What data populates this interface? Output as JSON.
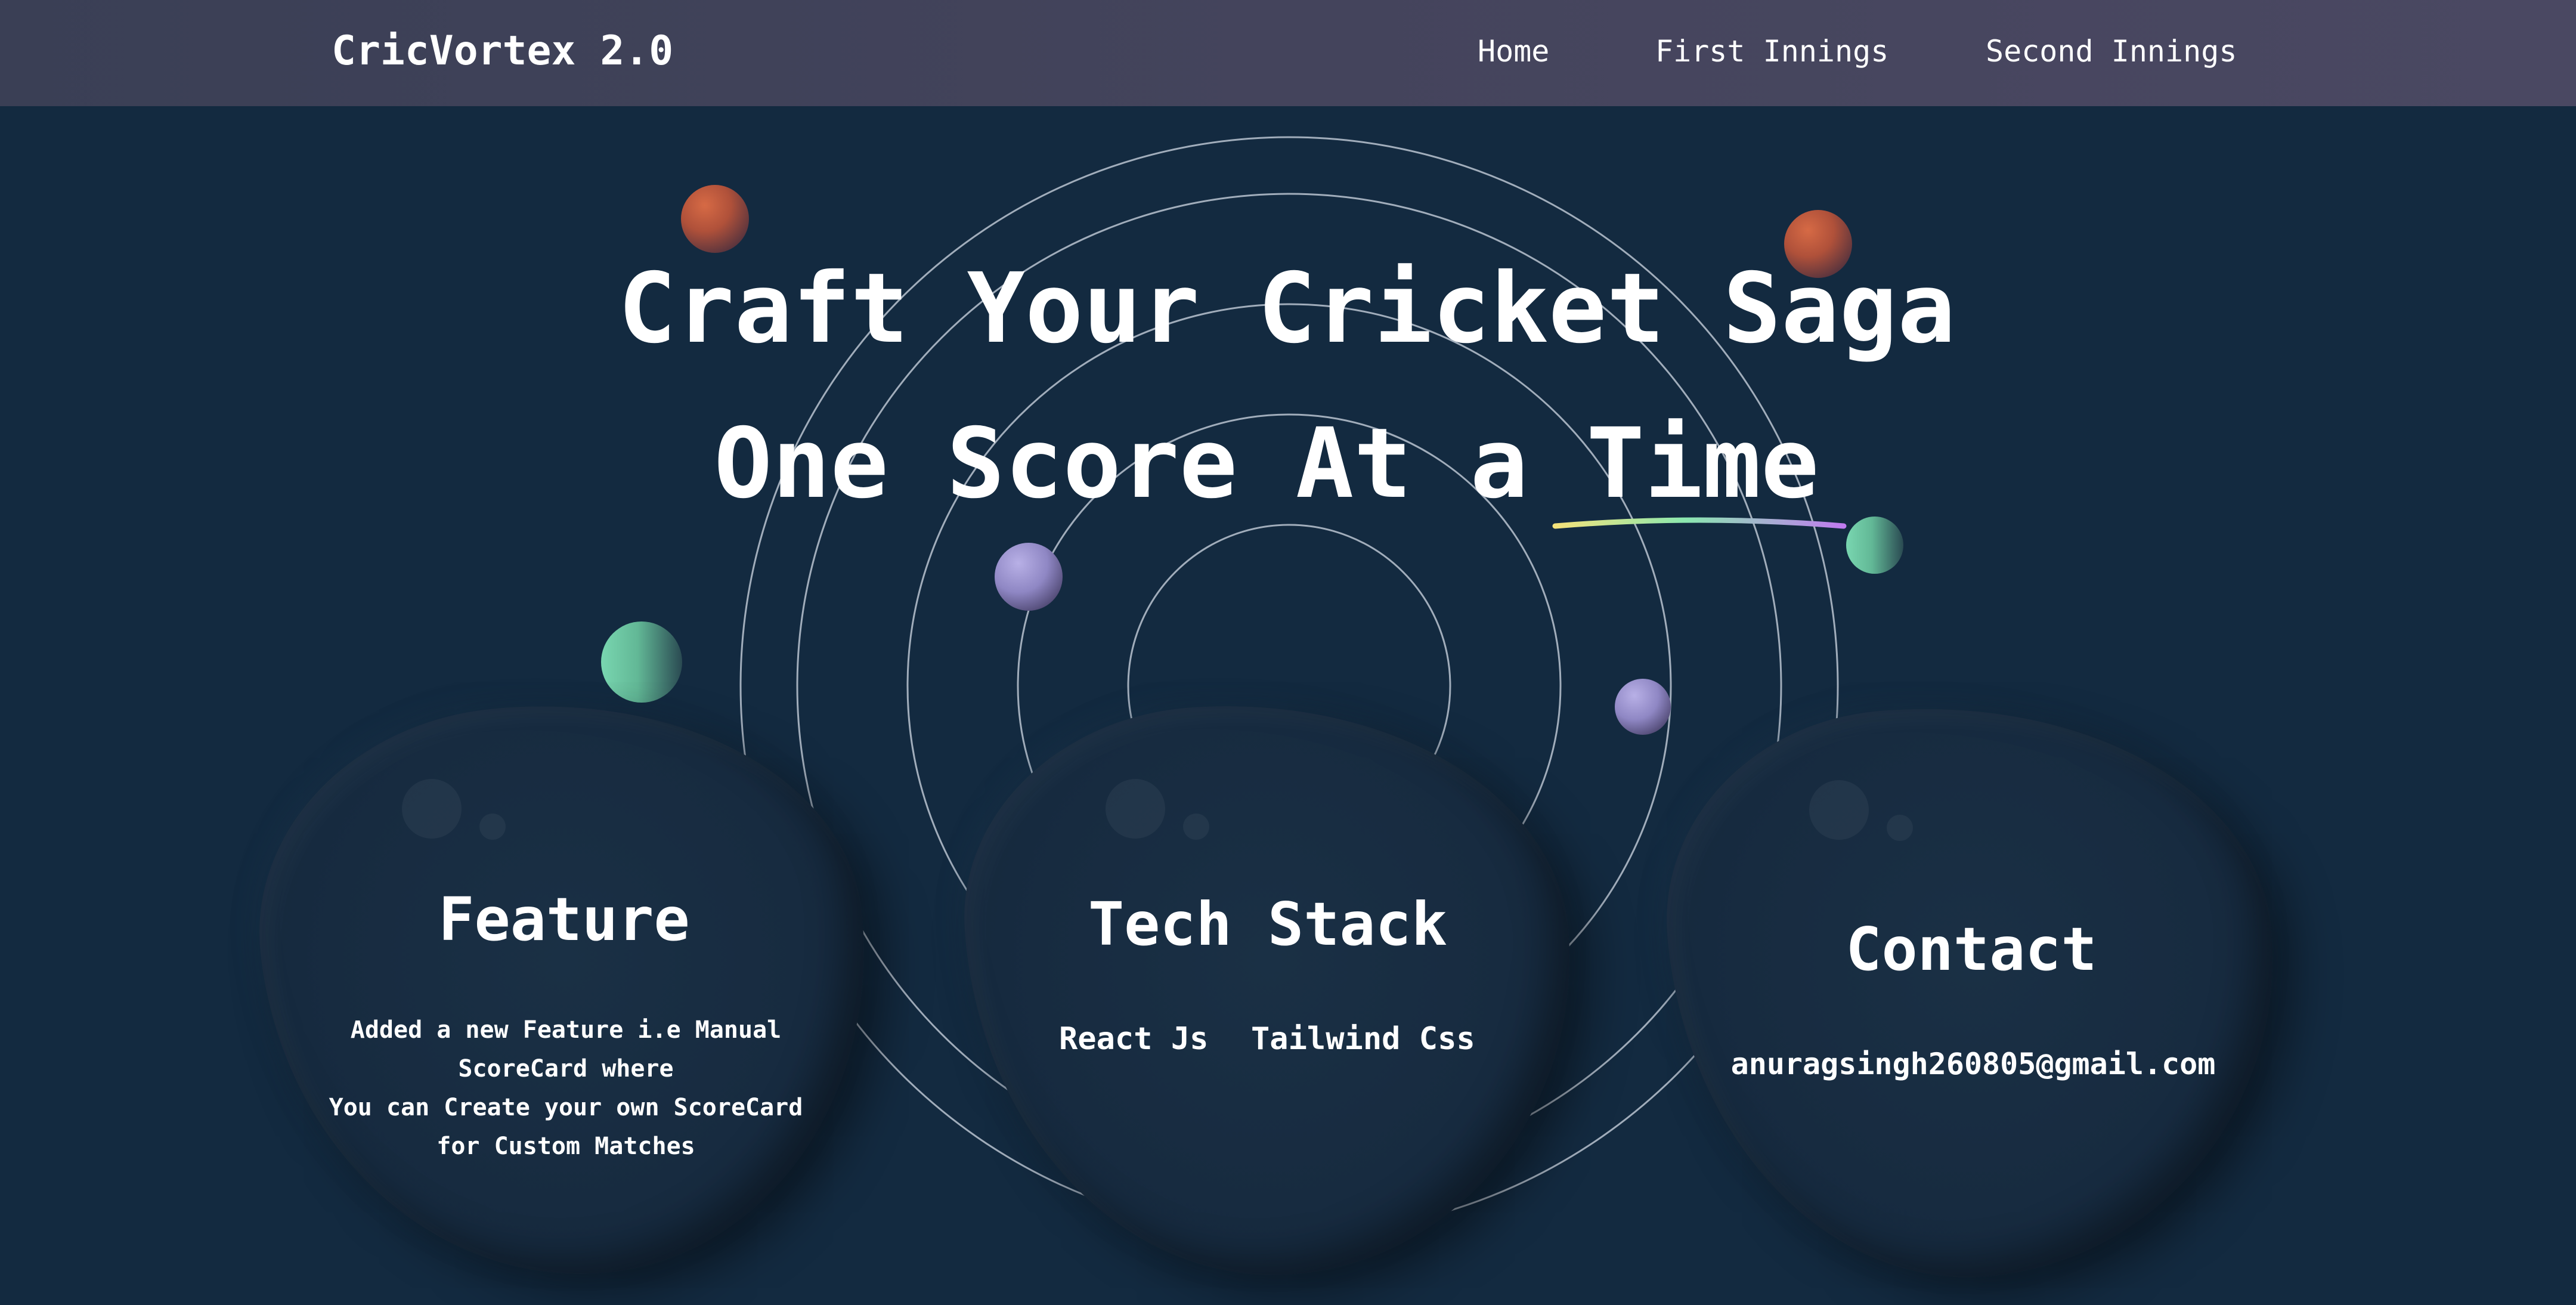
{
  "navbar": {
    "brand": "CricVortex 2.0",
    "links": [
      "Home",
      "First Innings",
      "Second Innings"
    ]
  },
  "hero": {
    "line1": "Craft Your Cricket Saga",
    "line2": "One Score At a Time"
  },
  "cards": {
    "feature": {
      "title": "Feature",
      "lines": [
        "Added a new Feature i.e Manual",
        "ScoreCard where",
        "You can Create your own ScoreCard",
        "for Custom Matches"
      ]
    },
    "tech": {
      "title": "Tech Stack",
      "items": [
        "React Js",
        "Tailwind Css"
      ]
    },
    "contact": {
      "title": "Contact",
      "email": "anuragsingh260805@gmail.com"
    }
  },
  "colors": {
    "background": "#132a40",
    "navbar": "#44445c",
    "text": "#ffffff",
    "sphere_orange": "#c65c3f",
    "sphere_lilac": "#9d95d2",
    "sphere_green": "#6fd0a8",
    "underline_start": "#f5e27a",
    "underline_mid": "#8be8b0",
    "underline_end": "#c07af0"
  },
  "icons": {
    "hero_underline": "gradient-underline-decoration",
    "rings": "concentric-rings-decoration"
  }
}
